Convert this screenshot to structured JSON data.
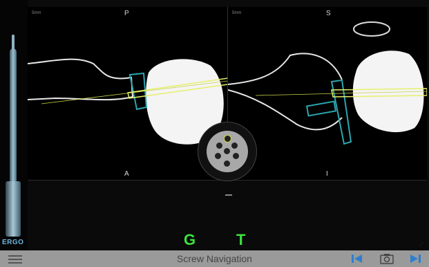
{
  "tool": {
    "brand": "ERGO"
  },
  "views": {
    "left": {
      "scale": "5mm",
      "top_label": "P",
      "bottom_label": "A"
    },
    "right": {
      "scale": "5mm",
      "top_label": "S",
      "bottom_label": "I"
    }
  },
  "indicators": {
    "g": "G",
    "t": "T"
  },
  "bottombar": {
    "title": "Screw Navigation"
  },
  "icons": {
    "menu": "hamburger-icon",
    "previous": "skip-previous-icon",
    "camera": "camera-icon",
    "next": "skip-next-icon"
  },
  "colors": {
    "screw": "#e6f06a",
    "guide": "#2ca6b0",
    "indicator": "#3de23d",
    "nav_button": "#2d7fd0"
  }
}
